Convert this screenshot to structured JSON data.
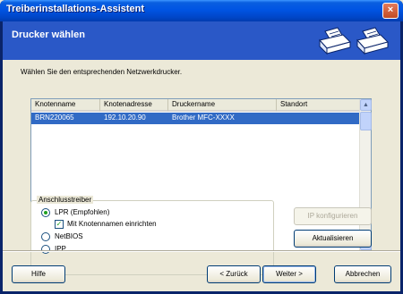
{
  "window": {
    "title": "Treiberinstallations-Assistent",
    "close_glyph": "×"
  },
  "header": {
    "title": "Drucker wählen"
  },
  "instruction": "Wählen Sie den entsprechenden Netzwerkdrucker.",
  "list": {
    "columns": [
      "Knotenname",
      "Knotenadresse",
      "Druckername",
      "Standort"
    ],
    "rows": [
      {
        "knotenname": "BRN220065",
        "knotenadresse": "192.10.20.90",
        "druckername": "Brother  MFC-XXXX",
        "standort": ""
      }
    ]
  },
  "driver_group": {
    "label": "Anschlusstreiber",
    "lpr": "LPR (Empfohlen)",
    "node_name_option": "Mit Knotennamen einrichten",
    "netbios": "NetBIOS",
    "ipp": "IPP",
    "selected": "LPR (Empfohlen)",
    "node_name_checked": true
  },
  "buttons": {
    "ip_config": "IP konfigurieren",
    "refresh": "Aktualisieren",
    "help": "Hilfe",
    "back": "< Zurück",
    "next": "Weiter >",
    "cancel": "Abbrechen"
  },
  "colors": {
    "title_bar": "#0054e3",
    "header": "#2a58c7",
    "selection": "#316ac5",
    "dialog": "#ece9d8"
  }
}
